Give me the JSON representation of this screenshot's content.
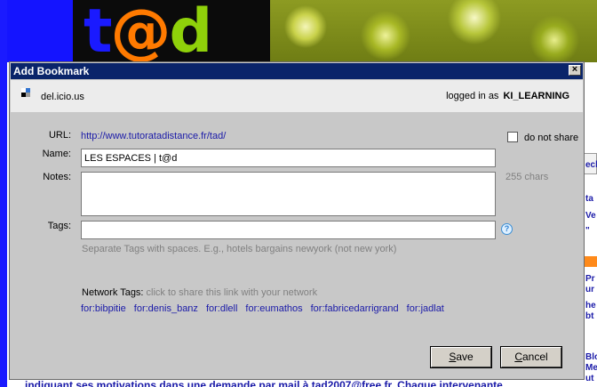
{
  "background": {
    "logo": {
      "t": "t",
      "at": "@",
      "d": "d"
    },
    "side_lines": [
      "ech",
      "ta",
      "Ve",
      "\"",
      "Pr",
      "ur",
      "he",
      "bt",
      "Blo",
      "Me",
      "ut"
    ],
    "bottom_text": "indiquant ses motivations dans une demande par mail à tad2007@free.fr. Chaque intervenante"
  },
  "dialog": {
    "title": "Add Bookmark",
    "close_glyph": "×",
    "site_name": "del.icio.us",
    "login_prefix": "logged in as",
    "login_user": "KI_LEARNING",
    "url_label": "URL:",
    "url_value": "http://www.tutoratadistance.fr/tad/",
    "do_not_share_label": "do not share",
    "do_not_share_checked": false,
    "name_label": "Name:",
    "name_value": "LES ESPACES | t@d",
    "notes_label": "Notes:",
    "notes_value": "",
    "chars_counter": "255 chars",
    "tags_label": "Tags:",
    "tags_value": "",
    "tags_hint": "Separate Tags with spaces. E.g., hotels bargains newyork (not new york)",
    "help_glyph": "?",
    "network_tags_label": "Network Tags:",
    "network_tags_hint": "click to share this link with your network",
    "network_tags": [
      "for:bibpitie",
      "for:denis_banz",
      "for:dlell",
      "for:eumathos",
      "for:fabricedarrigrand",
      "for:jadlat"
    ],
    "save_label": "Save",
    "cancel_label": "Cancel"
  },
  "colors": {
    "titlebar": "#0a246a",
    "dialog_bg": "#c8c8c8",
    "link": "#1a1aa8",
    "hint": "#808080"
  }
}
